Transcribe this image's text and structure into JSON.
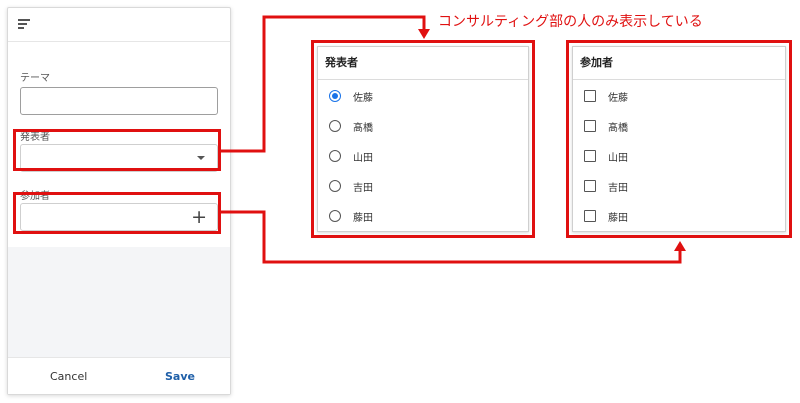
{
  "form": {
    "menu_icon": "hamburger-menu-icon",
    "fields": {
      "theme_label": "テーマ",
      "presenter_label": "発表者",
      "participants_label": "参加者"
    },
    "footer": {
      "cancel_label": "Cancel",
      "save_label": "Save"
    }
  },
  "annotation": "コンサルティング部の人のみ表示している",
  "presenter_popup": {
    "title": "発表者",
    "options": [
      {
        "label": "佐藤",
        "selected": true
      },
      {
        "label": "髙橋",
        "selected": false
      },
      {
        "label": "山田",
        "selected": false
      },
      {
        "label": "吉田",
        "selected": false
      },
      {
        "label": "藤田",
        "selected": false
      }
    ]
  },
  "participants_popup": {
    "title": "参加者",
    "options": [
      {
        "label": "佐藤",
        "checked": false
      },
      {
        "label": "髙橋",
        "checked": false
      },
      {
        "label": "山田",
        "checked": false
      },
      {
        "label": "吉田",
        "checked": false
      },
      {
        "label": "藤田",
        "checked": false
      }
    ]
  },
  "colors": {
    "highlight": "#e01010",
    "save_text": "#1f5fa8",
    "radio_selected": "#1a73e8"
  }
}
